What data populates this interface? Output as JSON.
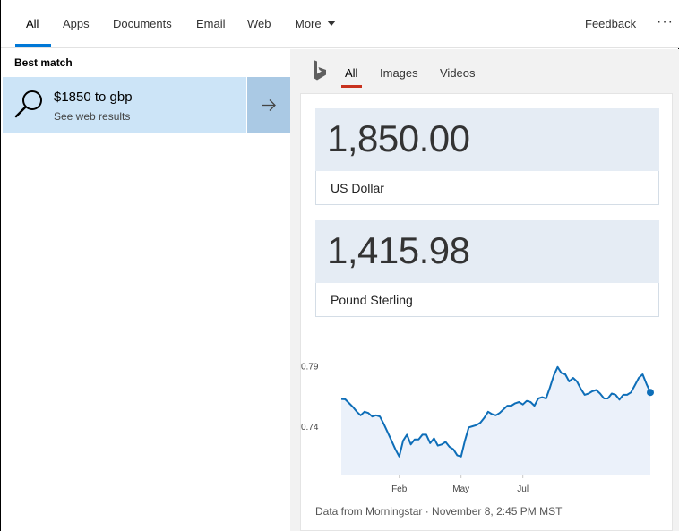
{
  "nav": {
    "tabs": [
      {
        "label": "All"
      },
      {
        "label": "Apps"
      },
      {
        "label": "Documents"
      },
      {
        "label": "Email"
      },
      {
        "label": "Web"
      },
      {
        "label": "More"
      }
    ],
    "feedback": "Feedback",
    "overflow": "···"
  },
  "left": {
    "section_title": "Best match",
    "result": {
      "title": "$1850 to gbp",
      "subtitle": "See web results",
      "icon": "search-icon",
      "action_icon": "arrow-right-icon"
    }
  },
  "right": {
    "tabs": [
      {
        "label": "All"
      },
      {
        "label": "Images"
      },
      {
        "label": "Videos"
      }
    ],
    "from": {
      "value": "1,850.00",
      "currency": "US Dollar"
    },
    "to": {
      "value": "1,415.98",
      "currency": "Pound Sterling"
    },
    "source": "Data from Morningstar · November 8, 2:45 PM MST"
  },
  "colors": {
    "accent": "#0078d7",
    "bing_underline": "#c8321e",
    "result_bg": "#cce4f7",
    "line": "#0e6eb8",
    "fill": "#ebf1fa"
  },
  "chart_data": {
    "type": "area",
    "x": [
      0,
      1,
      2,
      3,
      4,
      5,
      6,
      7,
      8,
      9,
      10,
      11,
      12,
      13,
      14,
      15,
      16,
      17,
      18,
      19,
      20,
      21,
      22,
      23,
      24,
      25,
      26,
      27,
      28,
      29,
      30,
      31,
      32,
      33,
      34,
      35,
      36,
      37,
      38,
      39,
      40,
      41,
      42,
      43,
      44,
      45,
      46,
      47,
      48,
      49,
      50,
      51,
      52,
      53,
      54,
      55,
      56,
      57,
      58,
      59,
      60,
      61,
      62,
      63,
      64,
      65,
      66,
      67,
      68,
      69,
      70,
      71,
      72,
      73,
      74,
      75,
      76,
      77,
      78,
      79,
      80
    ],
    "y": [
      0.7625,
      0.7623,
      0.7592,
      0.756,
      0.752,
      0.749,
      0.752,
      0.751,
      0.748,
      0.749,
      0.748,
      0.742,
      0.735,
      0.728,
      0.721,
      0.715,
      0.728,
      0.733,
      0.725,
      0.729,
      0.729,
      0.733,
      0.733,
      0.726,
      0.73,
      0.724,
      0.725,
      0.727,
      0.723,
      0.721,
      0.716,
      0.715,
      0.728,
      0.739,
      0.74,
      0.741,
      0.743,
      0.747,
      0.752,
      0.75,
      0.749,
      0.751,
      0.754,
      0.757,
      0.757,
      0.759,
      0.76,
      0.758,
      0.761,
      0.76,
      0.757,
      0.763,
      0.764,
      0.763,
      0.772,
      0.782,
      0.789,
      0.784,
      0.783,
      0.777,
      0.78,
      0.777,
      0.771,
      0.766,
      0.767,
      0.769,
      0.77,
      0.767,
      0.763,
      0.763,
      0.767,
      0.766,
      0.762,
      0.766,
      0.766,
      0.768,
      0.774,
      0.78,
      0.783,
      0.775,
      0.768
    ],
    "xticks": [
      {
        "at": 15,
        "label": "Feb"
      },
      {
        "at": 31,
        "label": "May"
      },
      {
        "at": 47,
        "label": "Jul"
      }
    ],
    "yticks": [
      0.79,
      0.74
    ],
    "ylim": [
      0.7,
      0.8
    ]
  }
}
